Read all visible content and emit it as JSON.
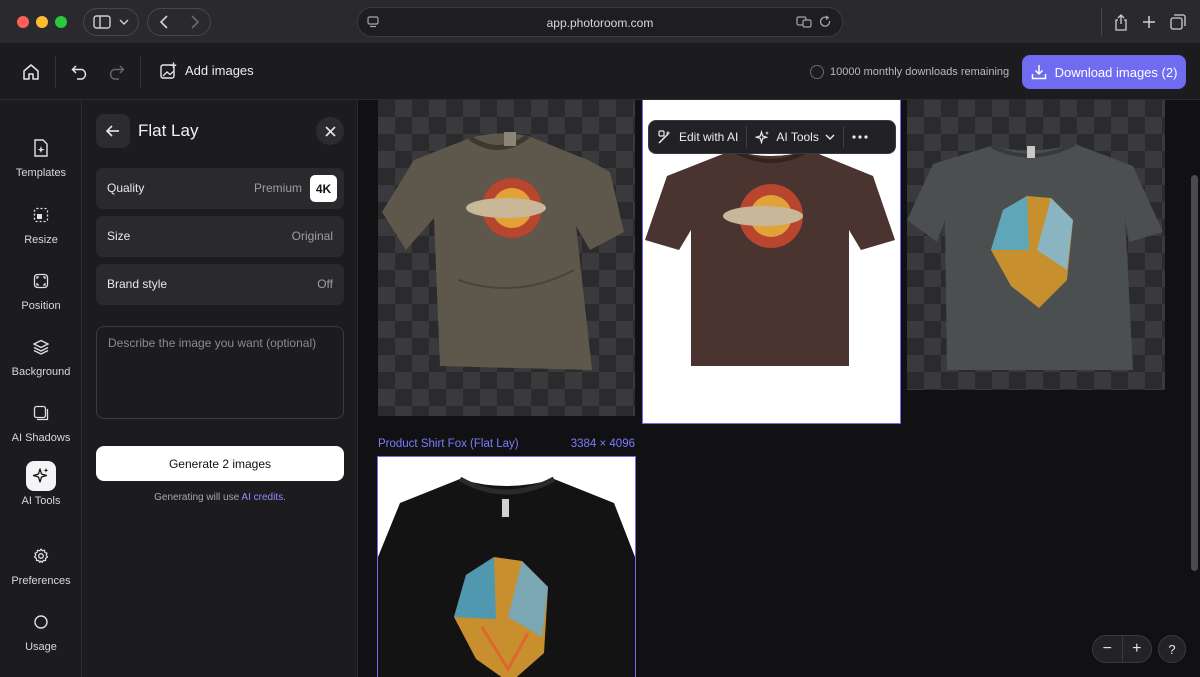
{
  "browser": {
    "url": "app.photoroom.com"
  },
  "toolbar": {
    "add_images_label": "Add images",
    "downloads_remaining": "10000 monthly downloads remaining",
    "download_label": "Download images (2)"
  },
  "rail": {
    "items": [
      {
        "label": "Templates",
        "icon": "template-icon"
      },
      {
        "label": "Resize",
        "icon": "resize-icon"
      },
      {
        "label": "Position",
        "icon": "position-icon"
      },
      {
        "label": "Background",
        "icon": "layers-icon"
      },
      {
        "label": "AI Shadows",
        "icon": "shadow-icon"
      },
      {
        "label": "AI Tools",
        "icon": "sparkle-icon",
        "active": true
      },
      {
        "label": "Preferences",
        "icon": "gear-icon"
      },
      {
        "label": "Usage",
        "icon": "usage-ring-icon"
      }
    ]
  },
  "panel": {
    "title": "Flat Lay",
    "quality_label": "Quality",
    "quality_value": "Premium",
    "quality_badge": "4K",
    "size_label": "Size",
    "size_value": "Original",
    "brand_label": "Brand style",
    "brand_value": "Off",
    "prompt_placeholder": "Describe the image you want (optional)",
    "generate_label": "Generate 2 images",
    "credits_prefix": "Generating will use",
    "credits_link": "AI credits",
    "credits_suffix": "."
  },
  "canvas": {
    "context_bar": {
      "edit_label": "Edit with AI",
      "tools_label": "AI Tools"
    },
    "cards": [
      {
        "shirt_color": "#5e574b"
      },
      {
        "shirt_color": "#4a3430"
      },
      {
        "shirt_color": "#4b4f50"
      },
      {
        "shirt_color": "#131314"
      }
    ],
    "caption_name": "Product Shirt Fox (Flat Lay)",
    "caption_dims": "3384 × 4096"
  },
  "zoom": {
    "minus": "−",
    "plus": "+",
    "help": "?"
  },
  "colors": {
    "accent": "#6f6cf2",
    "link": "#8e8bff"
  }
}
